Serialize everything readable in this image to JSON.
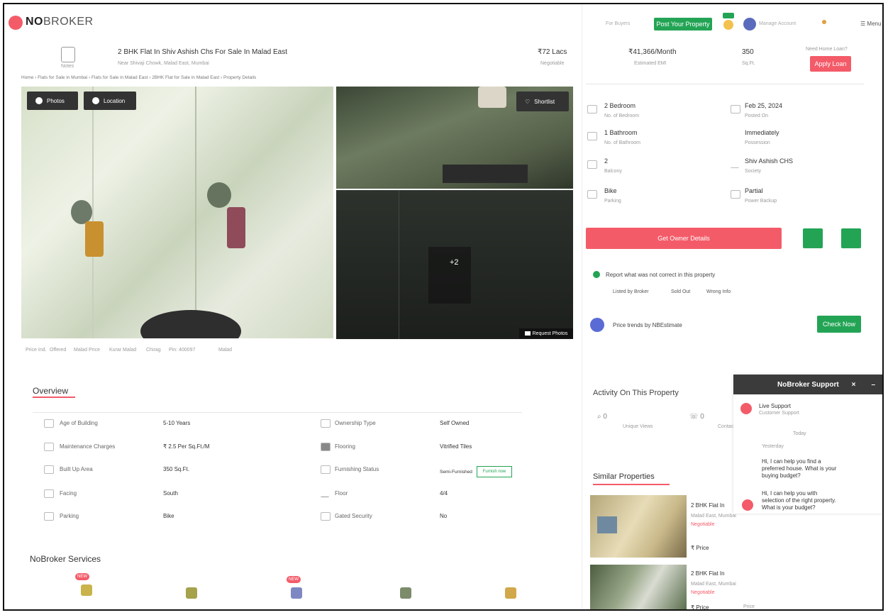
{
  "header": {
    "brand_bold": "NO",
    "brand_rest": "BROKER",
    "nav_small_text": "For Buyers",
    "post_property_label": "Post Your Property",
    "user_name": "Manage Account",
    "menu_label": "Menu"
  },
  "property": {
    "title": "2 BHK Flat In Shiv Ashish Chs For Sale In Malad East",
    "subtitle": "Near Shivaji Chowk, Malad East, Mumbai",
    "price": "₹72 Lacs",
    "price_sub": "Negotiable",
    "emi": "₹41,366/Month",
    "emi_label": "Estimated EMI",
    "area": "350",
    "area_label": "Sq.Ft.",
    "home_loan_text": "Need Home Loan?",
    "apply_loan": "Apply Loan",
    "breadcrumb": "Home › Flats for Sale in Mumbai › Flats for Sale in Malad East › 2BHK Flat for Sale in Malad East › Property Details",
    "logo_caption": "Notes"
  },
  "gallery": {
    "photos_label": "Photos",
    "location_label": "Location",
    "shortlist_label": "Shortlist",
    "more_count": "+2",
    "request_photos": "Request Photos"
  },
  "tags": [
    "Price Ind.",
    "Offered",
    "Malad Price",
    "Kurar Malad",
    "Chirag",
    "Pin: 400097",
    "Malad"
  ],
  "facts": [
    {
      "value": "2 Bedroom",
      "label": "No. of Bedroom",
      "side": "left"
    },
    {
      "value": "Feb 25, 2024",
      "label": "Posted On",
      "side": "right"
    },
    {
      "value": "1 Bathroom",
      "label": "No. of Bathroom",
      "side": "left"
    },
    {
      "value": "Immediately",
      "label": "Possession",
      "side": "right"
    },
    {
      "value": "2",
      "label": "Balcony",
      "side": "left"
    },
    {
      "value": "Shiv Ashish CHS",
      "label": "Society",
      "side": "right"
    },
    {
      "value": "Bike",
      "label": "Parking",
      "side": "left"
    },
    {
      "value": "Partial",
      "label": "Power Backup",
      "side": "right"
    }
  ],
  "contact": {
    "get_owner_label": "Get Owner Details"
  },
  "report": {
    "text": "Report what was not correct in this property",
    "options": [
      "Listed by Broker",
      "Sold Out",
      "Wrong Info"
    ]
  },
  "price_trends": {
    "text": "Price trends by NBEstimate",
    "button": "Check Now"
  },
  "activity": {
    "title": "Activity On This Property",
    "stats": [
      {
        "value": "0",
        "label": "Unique Views"
      },
      {
        "value": "0",
        "label": "Contacted"
      }
    ]
  },
  "support": {
    "title": "NoBroker Support",
    "agent_name": "Live Support",
    "agent_status": "Customer Support",
    "today_label": "Today",
    "greeting_label": "Yesterday",
    "msg1": "Hi, I can help you find a preferred house. What is your buying budget?",
    "msg2": "Hi, I can help you with selection of the right property. What is your budget?"
  },
  "similar": {
    "title": "Similar Properties",
    "items": [
      {
        "title": "2 BHK Flat In",
        "sub": "Malad East, Mumbai",
        "meta": "Negotiable",
        "price": "₹ Price"
      },
      {
        "title": "2 BHK Flat In",
        "sub": "Malad East, Mumbai",
        "meta": "Negotiable",
        "price": "₹ Price"
      }
    ],
    "price_label": "Price"
  },
  "overview": {
    "title": "Overview",
    "left": [
      {
        "label": "Age of Building",
        "value": "5-10 Years",
        "icon": "building-icon"
      },
      {
        "label": "Maintenance Charges",
        "value": "₹ 2.5 Per Sq.Ft./M",
        "icon": "wallet-icon"
      },
      {
        "label": "Built Up Area",
        "value": "350 Sq.Ft.",
        "icon": "area-icon"
      },
      {
        "label": "Facing",
        "value": "South",
        "icon": "compass-icon"
      },
      {
        "label": "Parking",
        "value": "Bike",
        "icon": "car-icon"
      }
    ],
    "right": [
      {
        "label": "Ownership Type",
        "value": "Self Owned",
        "icon": "ownership-icon"
      },
      {
        "label": "Flooring",
        "value": "Vitrified Tiles",
        "icon": "flooring-icon"
      },
      {
        "label": "Furnishing Status",
        "value": "Semi-Furnished",
        "icon": "sofa-icon"
      },
      {
        "label": "Floor",
        "value": "4/4",
        "icon": "floor-icon"
      },
      {
        "label": "Gated Security",
        "value": "No",
        "icon": "security-icon"
      }
    ],
    "furnish_button": "Furnish now"
  },
  "services": {
    "title": "NoBroker Services",
    "new_badge": "NEW"
  },
  "colors": {
    "brand": "#f45b69",
    "green": "#23a455",
    "dark": "#333333"
  }
}
